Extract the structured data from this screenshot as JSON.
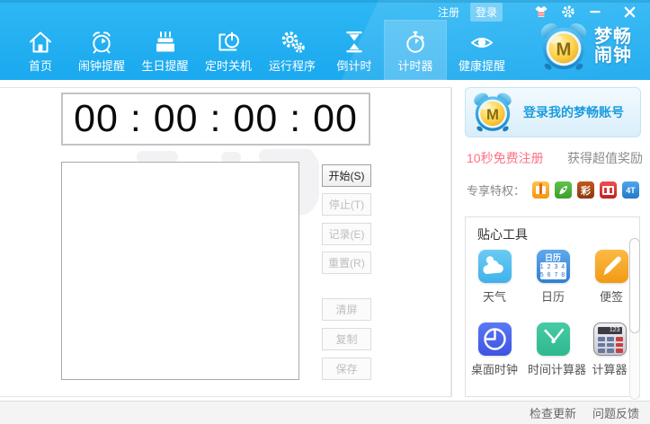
{
  "window": {
    "register_label": "注册",
    "login_label": "登录"
  },
  "toolbar": {
    "items": [
      {
        "label": "首页",
        "icon": "home-icon",
        "active": false
      },
      {
        "label": "闹钟提醒",
        "icon": "alarm-icon",
        "active": false
      },
      {
        "label": "生日提醒",
        "icon": "birthday-cake-icon",
        "active": false
      },
      {
        "label": "定时关机",
        "icon": "shutdown-icon",
        "active": false
      },
      {
        "label": "运行程序",
        "icon": "gears-icon",
        "active": false
      },
      {
        "label": "倒计时",
        "icon": "hourglass-icon",
        "active": false
      },
      {
        "label": "计时器",
        "icon": "stopwatch-icon",
        "active": true
      },
      {
        "label": "健康提醒",
        "icon": "eye-icon",
        "active": false
      }
    ]
  },
  "logo": {
    "line1": "梦畅",
    "line2": "闹钟",
    "letter": "M"
  },
  "timer": {
    "display": "00 : 00 : 00 : 00"
  },
  "buttons": {
    "start": "开始(S)",
    "stop": "停止(T)",
    "record": "记录(E)",
    "reset": "重置(R)",
    "clear": "清屏",
    "copy": "复制",
    "save": "保存"
  },
  "sidebar": {
    "login_button": "登录我的梦畅账号",
    "promo": "10秒免费注册",
    "reward": "获得超值奖励",
    "privileges_label": "专享特权：",
    "privileges": [
      {
        "name": "gift-orange-icon",
        "text": ""
      },
      {
        "name": "rocket-green-icon",
        "text": ""
      },
      {
        "name": "lottery-icon",
        "text": "彩"
      },
      {
        "name": "gift-red-icon",
        "text": ""
      },
      {
        "name": "cloud-4t-icon",
        "text": "4T"
      }
    ],
    "tools_title": "贴心工具",
    "tools": [
      {
        "label": "天气"
      },
      {
        "label": "日历",
        "cal_header": "日历",
        "cal_row1": "1 2 3 4",
        "cal_row2": "5 6 7 8"
      },
      {
        "label": "便签"
      },
      {
        "label": "桌面时钟"
      },
      {
        "label": "时间计算器"
      },
      {
        "label": "计算器",
        "display": "123"
      }
    ]
  },
  "statusbar": {
    "check_update": "检查更新",
    "feedback": "问题反馈"
  },
  "colors": {
    "header_blue": "#1ba9ef",
    "active_tab": "rgba(255,255,255,0.20)",
    "login_text": "#189bdf",
    "promo_pink": "#ff7083",
    "panel_border": "#c5e4f6"
  }
}
